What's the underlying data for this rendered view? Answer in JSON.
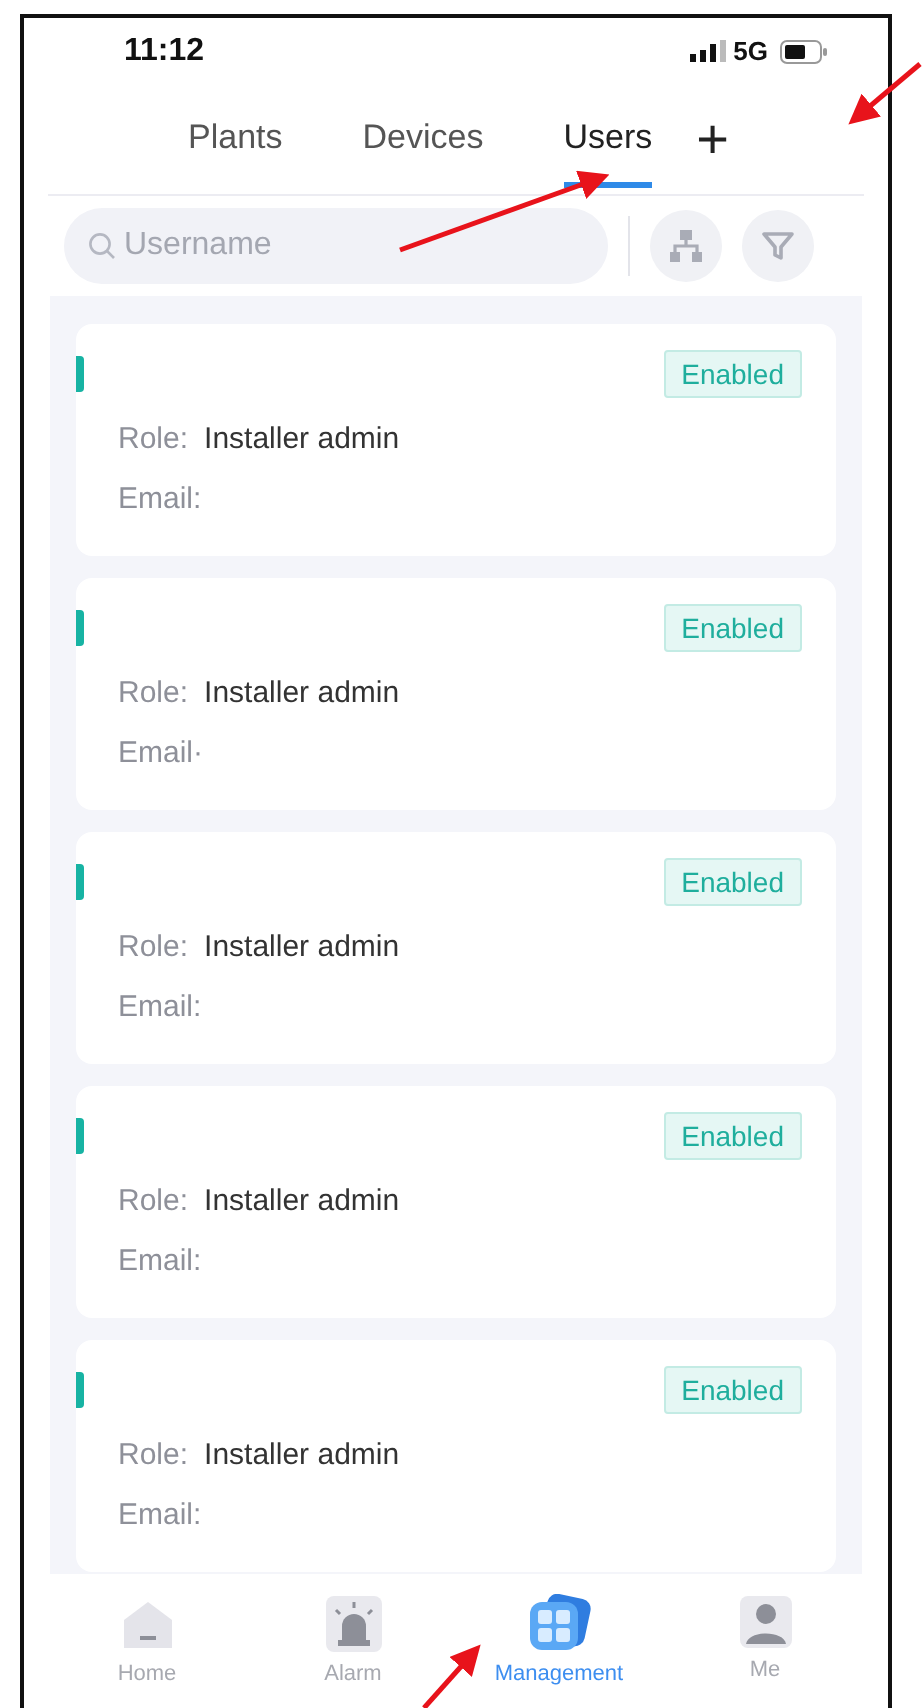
{
  "status_bar": {
    "time": "11:12",
    "network": "5G"
  },
  "tabs": [
    {
      "label": "Plants",
      "selected": false
    },
    {
      "label": "Devices",
      "selected": false
    },
    {
      "label": "Users",
      "selected": true
    }
  ],
  "add_button": {
    "label": "+"
  },
  "search": {
    "placeholder": "Username"
  },
  "users": [
    {
      "role_label": "Role:",
      "role": "Installer admin",
      "email_label": "Email:",
      "status": "Enabled"
    },
    {
      "role_label": "Role:",
      "role": "Installer admin",
      "email_label": "Email·",
      "status": "Enabled"
    },
    {
      "role_label": "Role:",
      "role": "Installer admin",
      "email_label": "Email:",
      "status": "Enabled"
    },
    {
      "role_label": "Role:",
      "role": "Installer admin",
      "email_label": "Email:",
      "status": "Enabled"
    },
    {
      "role_label": "Role:",
      "role": "Installer admin",
      "email_label": "Email:",
      "status": "Enabled"
    }
  ],
  "nav": [
    {
      "label": "Home",
      "kind": "home",
      "selected": false
    },
    {
      "label": "Alarm",
      "kind": "alarm",
      "selected": false
    },
    {
      "label": "Management",
      "kind": "management",
      "selected": true
    },
    {
      "label": "Me",
      "kind": "me",
      "selected": false
    }
  ]
}
